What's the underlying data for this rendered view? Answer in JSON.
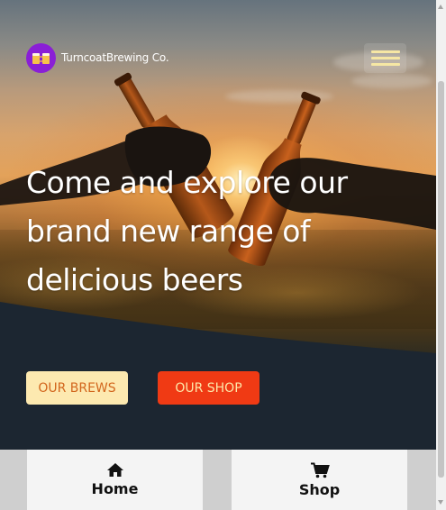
{
  "header": {
    "brand": "TurncoatBrewing Co.",
    "logo_icon": "beer-mugs-icon",
    "menu_icon": "hamburger-menu-icon"
  },
  "hero": {
    "headline": "Come and explore our brand new range of delicious beers"
  },
  "buttons": {
    "brews": "OUR BREWS",
    "shop": "OUR SHOP"
  },
  "bottom_nav": {
    "home": {
      "label": "Home",
      "icon": "home-icon"
    },
    "shop": {
      "label": "Shop",
      "icon": "shopping-cart-icon"
    }
  },
  "colors": {
    "logo_bg": "#8a1fd6",
    "dark_section": "#1c2631",
    "menu_lines": "#f6e7a4",
    "brews_button_bg": "#fde9b0",
    "brews_button_text": "#d2661d",
    "shop_button_bg": "#f03a14",
    "shop_button_text": "#fde7a8"
  }
}
